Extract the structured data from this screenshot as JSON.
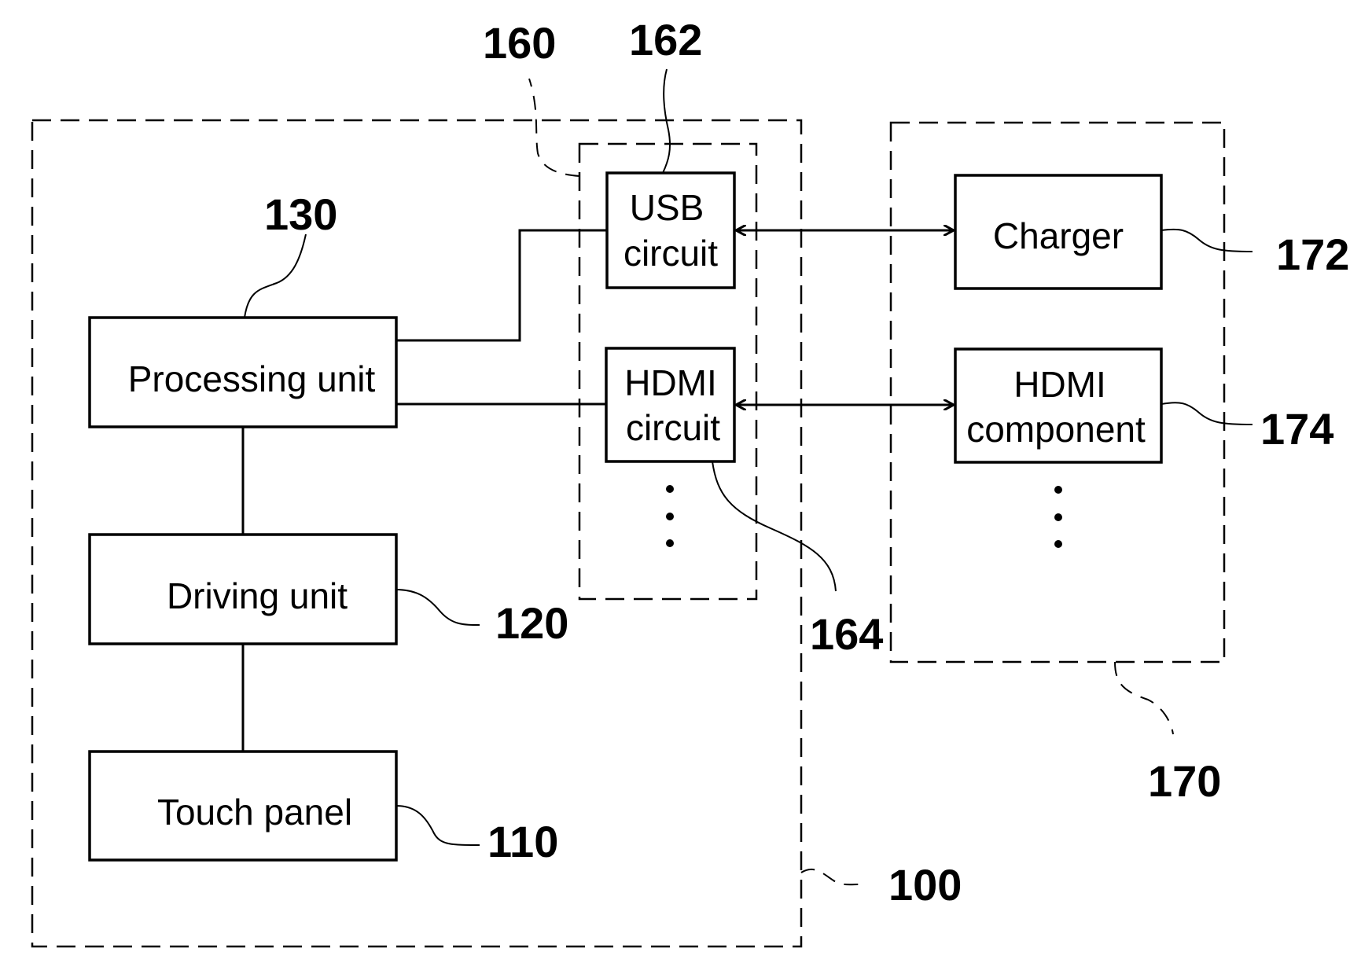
{
  "diagram": {
    "type": "block-diagram",
    "blocks": {
      "processing_unit": {
        "label": "Processing unit",
        "ref": "130"
      },
      "driving_unit": {
        "label": "Driving unit",
        "ref": "120"
      },
      "touch_panel": {
        "label": "Touch panel",
        "ref": "110"
      },
      "usb_circuit": {
        "label_line1": "USB",
        "label_line2": "circuit",
        "ref": "162"
      },
      "hdmi_circuit": {
        "label_line1": "HDMI",
        "label_line2": "circuit",
        "ref": "164"
      },
      "charger": {
        "label": "Charger",
        "ref": "172"
      },
      "hdmi_component": {
        "label_line1": "HDMI",
        "label_line2": "component",
        "ref": "174"
      }
    },
    "groups": {
      "device": {
        "ref": "100"
      },
      "interface_module": {
        "ref": "160"
      },
      "external_devices": {
        "ref": "170"
      }
    },
    "connections": [
      {
        "from": "Processing unit",
        "to": "USB circuit",
        "type": "line"
      },
      {
        "from": "Processing unit",
        "to": "HDMI circuit",
        "type": "line"
      },
      {
        "from": "Processing unit",
        "to": "Driving unit",
        "type": "line"
      },
      {
        "from": "Driving unit",
        "to": "Touch panel",
        "type": "line"
      },
      {
        "from": "USB circuit",
        "to": "Charger",
        "type": "bidirectional-arrow"
      },
      {
        "from": "HDMI circuit",
        "to": "HDMI component",
        "type": "bidirectional-arrow"
      }
    ]
  }
}
